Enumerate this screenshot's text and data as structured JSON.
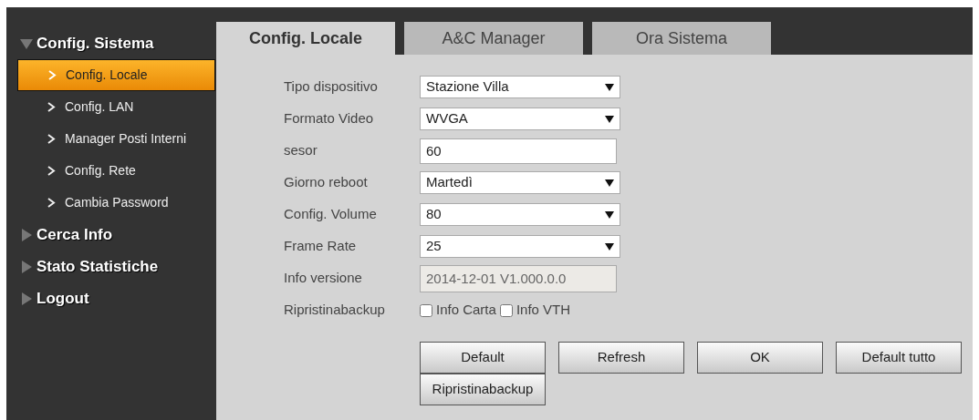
{
  "sidebar": {
    "groups": [
      {
        "label": "Config. Sistema",
        "expanded": true,
        "children": [
          {
            "label": "Config. Locale",
            "selected": true
          },
          {
            "label": "Config. LAN",
            "selected": false
          },
          {
            "label": "Manager Posti Interni",
            "selected": false
          },
          {
            "label": "Config. Rete",
            "selected": false
          },
          {
            "label": "Cambia Password",
            "selected": false
          }
        ]
      },
      {
        "label": "Cerca Info",
        "expanded": false
      },
      {
        "label": "Stato Statistiche",
        "expanded": false
      },
      {
        "label": "Logout",
        "expanded": false
      }
    ]
  },
  "tabs": [
    {
      "label": "Config. Locale",
      "selected": true
    },
    {
      "label": "A&C Manager",
      "selected": false
    },
    {
      "label": "Ora Sistema",
      "selected": false
    }
  ],
  "form": [
    {
      "kind": "select",
      "label": "Tipo dispositivo",
      "value": "Stazione Villa"
    },
    {
      "kind": "select",
      "label": "Formato Video",
      "value": "WVGA"
    },
    {
      "kind": "text",
      "label": "sesor",
      "value": "60"
    },
    {
      "kind": "select",
      "label": "Giorno reboot",
      "value": "Martedì"
    },
    {
      "kind": "select",
      "label": "Config. Volume",
      "value": "80"
    },
    {
      "kind": "select",
      "label": "Frame Rate",
      "value": "25"
    },
    {
      "kind": "readonly",
      "label": "Info versione",
      "value": "2014-12-01 V1.000.0.0"
    },
    {
      "kind": "checkboxes",
      "label": "Ripristinabackup",
      "options": [
        {
          "label": "Info Carta",
          "checked": false
        },
        {
          "label": "Info VTH",
          "checked": false
        }
      ]
    }
  ],
  "buttons": [
    [
      "Default",
      "Refresh",
      "OK",
      "Default tutto"
    ],
    [
      "Ripristinabackup"
    ]
  ]
}
